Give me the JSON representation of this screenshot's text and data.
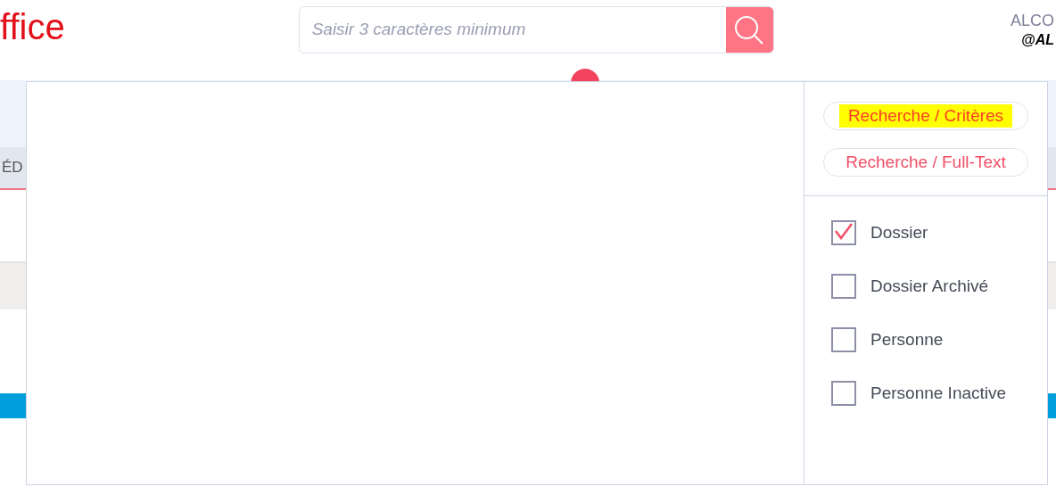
{
  "header": {
    "logo": "ffice",
    "search": {
      "placeholder": "Saisir 3 caractères minimum"
    },
    "user": {
      "name": "ALCO",
      "handle": "@AL"
    }
  },
  "background": {
    "left_column_header": "ÉD"
  },
  "search_panel": {
    "modes": [
      {
        "label": "Recherche / Critères",
        "highlighted": true
      },
      {
        "label": "Recherche / Full-Text",
        "highlighted": false
      }
    ],
    "filters": [
      {
        "label": "Dossier",
        "checked": true
      },
      {
        "label": "Dossier Archivé",
        "checked": false
      },
      {
        "label": "Personne",
        "checked": false
      },
      {
        "label": "Personne Inactive",
        "checked": false
      }
    ]
  }
}
